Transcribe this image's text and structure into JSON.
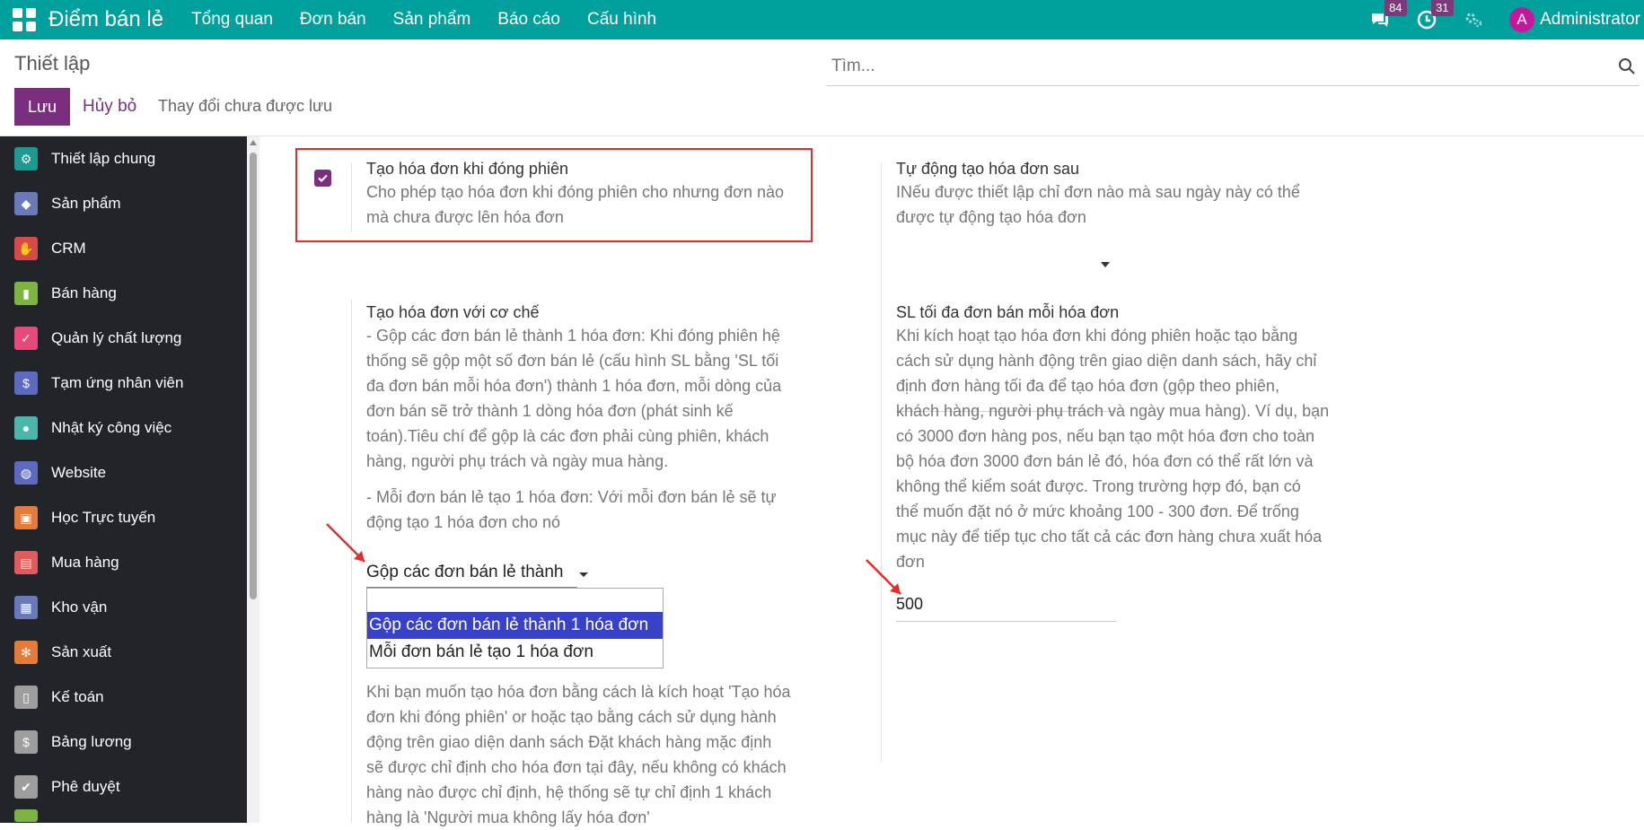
{
  "navbar": {
    "brand": "Điểm bán lẻ",
    "menu": [
      "Tổng quan",
      "Đơn bán",
      "Sản phẩm",
      "Báo cáo",
      "Cấu hình"
    ],
    "messages_badge": "84",
    "activities_badge": "31",
    "user_initial": "A",
    "user_name": "Administrator"
  },
  "control": {
    "title": "Thiết lập",
    "search_placeholder": "Tìm...",
    "save_label": "Lưu",
    "cancel_label": "Hủy bỏ",
    "unsaved_label": "Thay đổi chưa được lưu"
  },
  "sidebar": {
    "items": [
      {
        "label": "Thiết lập chung",
        "icon": "gear-icon",
        "color": "#1d9a8f"
      },
      {
        "label": "Sản phẩm",
        "icon": "tag-icon",
        "color": "#6a7ab8"
      },
      {
        "label": "CRM",
        "icon": "handshake-icon",
        "color": "#d74a4a"
      },
      {
        "label": "Bán hàng",
        "icon": "chart-icon",
        "color": "#7cb342"
      },
      {
        "label": "Quản lý chất lượng",
        "icon": "check-icon",
        "color": "#e64a7a"
      },
      {
        "label": "Tạm ứng nhân viên",
        "icon": "hand-money-icon",
        "color": "#5c6bc0"
      },
      {
        "label": "Nhật ký công việc",
        "icon": "people-icon",
        "color": "#4db6ac"
      },
      {
        "label": "Website",
        "icon": "globe-icon",
        "color": "#5c6bc0"
      },
      {
        "label": "Học Trực tuyến",
        "icon": "presentation-icon",
        "color": "#e57b3a"
      },
      {
        "label": "Mua hàng",
        "icon": "cart-icon",
        "color": "#e05c5c"
      },
      {
        "label": "Kho vận",
        "icon": "box-icon",
        "color": "#6a7ab8"
      },
      {
        "label": "Sản xuất",
        "icon": "wrench-gear-icon",
        "color": "#e57b3a"
      },
      {
        "label": "Kế toán",
        "icon": "invoice-icon",
        "color": "#9e9e9e"
      },
      {
        "label": "Bảng lương",
        "icon": "payroll-icon",
        "color": "#9e9e9e"
      },
      {
        "label": "Phê duyệt",
        "icon": "approval-icon",
        "color": "#9e9e9e"
      }
    ]
  },
  "settings": {
    "invoice_on_close": {
      "title": "Tạo hóa đơn khi đóng phiên",
      "desc": [
        "Cho phép tạo hóa đơn khi đóng phiên cho nhưng đơn nào",
        "mà chưa được lên hóa đơn"
      ],
      "checked": true
    },
    "auto_invoice_after": {
      "title": "Tự động tạo hóa đơn sau",
      "desc": [
        "INếu được thiết lập chỉ đơn nào mà sau ngày này có thể",
        "được tự động tạo hóa đơn"
      ]
    },
    "invoice_mechanism": {
      "title": "Tạo hóa đơn với cơ chế",
      "desc": [
        "- Gộp các đơn bán lẻ thành 1 hóa đơn: Khi đóng phiên hệ",
        "thống sẽ gộp một số đơn bán lẻ (cấu hình SL bằng 'SL tối",
        "đa đơn bán mỗi hóa đơn') thành 1 hóa đơn, mỗi dòng của",
        "đơn bán sẽ trở thành 1 dòng hóa đơn (phát sinh kế",
        "toán).Tiêu chí để gộp là các đơn phải cùng phiên, khách",
        "hàng, người phụ trách và ngày mua hàng."
      ],
      "desc2": [
        "- Mỗi đơn bán lẻ tạo 1 hóa đơn: Với mỗi đơn bán lẻ sẽ tự",
        "động tạo 1 hóa đơn cho nó"
      ],
      "selected": "Gộp các đơn bán lẻ thành",
      "options": [
        "Gộp các đơn bán lẻ thành 1 hóa đơn",
        "Mỗi đơn bán lẻ tạo 1 hóa đơn"
      ]
    },
    "max_orders": {
      "title": "SL tối đa đơn bán mỗi hóa đơn",
      "desc": [
        "Khi kích hoạt tạo hóa đơn khi đóng phiên hoặc tạo bằng",
        "cách sử dụng hành động trên giao diện danh sách, hãy chỉ",
        "định đơn hàng tối đa để tạo hóa đơn (gộp theo phiên,",
        "khách hàng, người phụ trách và ngày mua hàng). Ví dụ, bạn",
        "có 3000 đơn hàng pos, nếu bạn tạo một hóa đơn cho toàn",
        "bộ hóa đơn 3000 đơn bán lẻ đó, hóa đơn có thể rất lớn và",
        "không thể kiểm soát được. Trong trường hợp đó, bạn có",
        "thể muốn đặt nó ở mức khoảng 100 - 300 đơn. Để trống",
        "mục này để tiếp tục cho tất cả các đơn hàng chưa xuất hóa",
        "đơn"
      ],
      "value": "500"
    },
    "default_customer": {
      "desc": [
        "Khi bạn muốn tạo hóa đơn bằng cách là kích hoạt 'Tạo hóa",
        "đơn khi đóng phiên' or hoặc tạo bằng cách sử dụng hành",
        "động trên giao diện danh sách Đặt khách hàng mặc định",
        "sẽ được chỉ định cho hóa đơn tại đây, nếu không có khách",
        "hàng nào được chỉ định, hệ thống sẽ tự chỉ định 1 khách",
        "hàng là 'Người mua không lấy hóa đơn'"
      ]
    }
  }
}
